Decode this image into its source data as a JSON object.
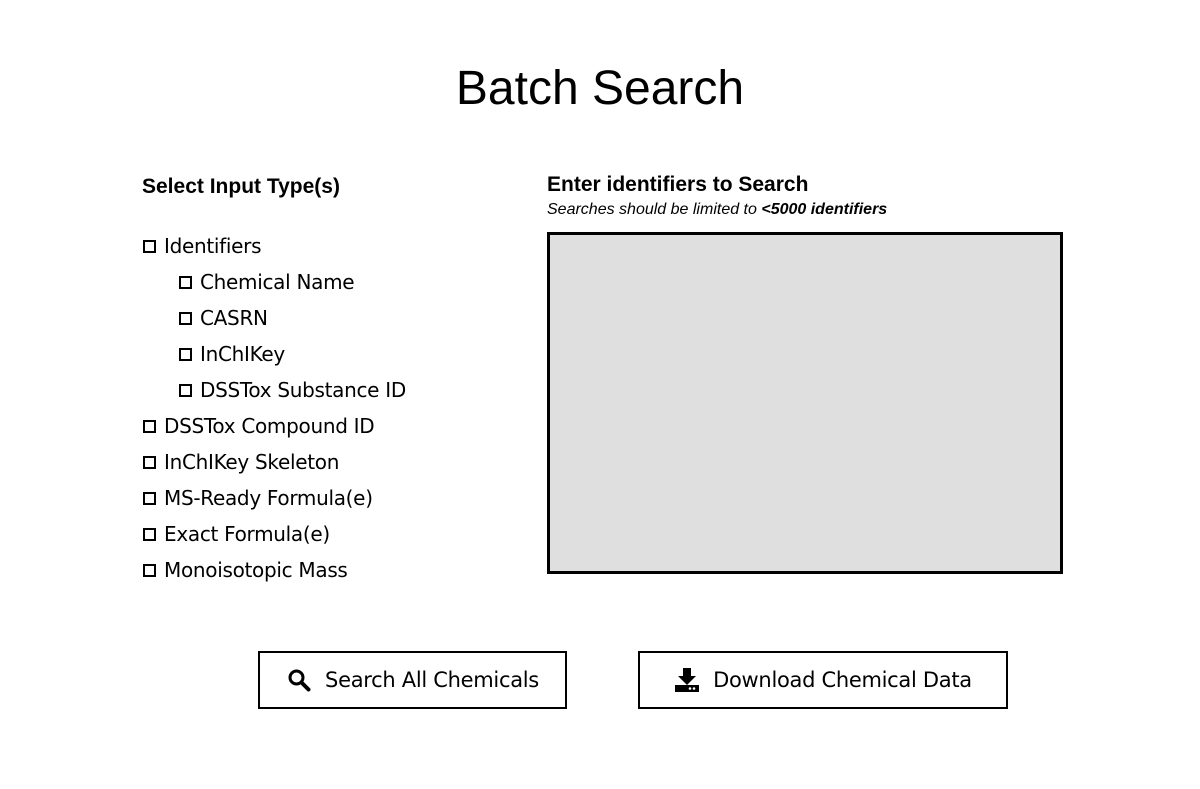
{
  "page": {
    "title": "Batch Search"
  },
  "input_types": {
    "heading": "Select Input Type(s)",
    "options": [
      {
        "label": "Identifiers",
        "checked": false
      },
      {
        "label": "Chemical Name",
        "checked": false
      },
      {
        "label": "CASRN",
        "checked": false
      },
      {
        "label": "InChIKey",
        "checked": false
      },
      {
        "label": "DSSTox Substance ID",
        "checked": false
      },
      {
        "label": "DSSTox Compound ID",
        "checked": false
      },
      {
        "label": "InChIKey Skeleton",
        "checked": false
      },
      {
        "label": "MS-Ready Formula(e)",
        "checked": false
      },
      {
        "label": "Exact Formula(e)",
        "checked": false
      },
      {
        "label": "Monoisotopic Mass",
        "checked": false
      }
    ]
  },
  "search": {
    "heading": "Enter identifiers to Search",
    "note_prefix": "Searches should be limited to ",
    "note_emphasis": "<5000 identifiers",
    "input_value": ""
  },
  "actions": {
    "search_label": "Search All Chemicals",
    "search_icon": "search-icon",
    "download_label": "Download Chemical Data",
    "download_icon": "download-icon"
  },
  "colors": {
    "text": "#000000",
    "background": "#ffffff",
    "input_background": "#dfdfdf"
  }
}
